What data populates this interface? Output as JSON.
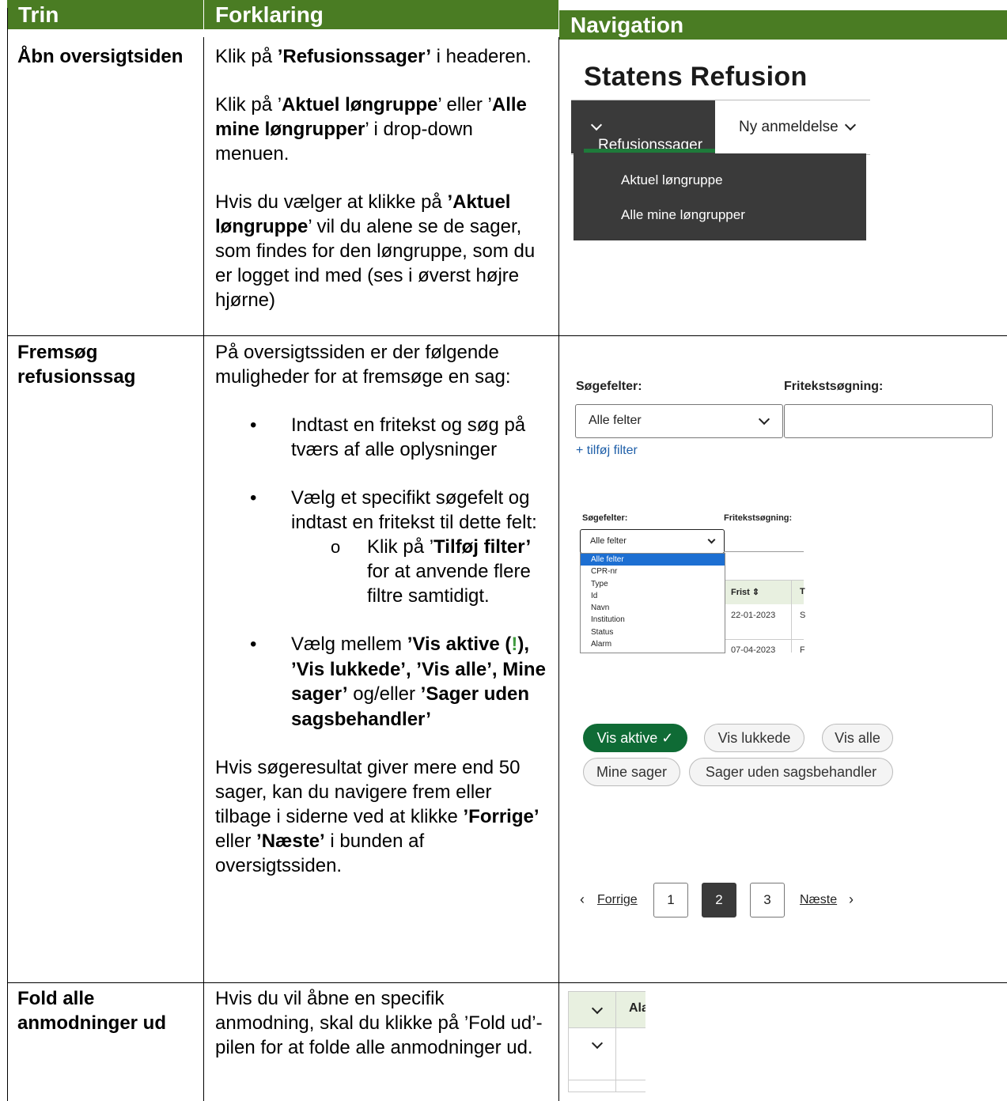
{
  "header": {
    "col1": "Trin",
    "col2": "Forklaring",
    "col3": "Navigation"
  },
  "row1": {
    "step": "Åbn oversigtsiden",
    "p1_a": "Klik på ",
    "p1_b": "’Refusionssager’",
    "p1_c": " i headeren.",
    "p2_a": "Klik på ’",
    "p2_b": "Aktuel løngruppe",
    "p2_c": "’ eller ’",
    "p2_d": "Alle mine løngrupper",
    "p2_e": "’ i drop-down menuen.",
    "p3_a": "Hvis du vælger at klikke på ",
    "p3_b": "’Aktuel løngruppe",
    "p3_c": "’ vil du alene se de sager, som findes for den løngruppe, som du er logget ind med (ses i øverst højre hjørne)"
  },
  "row2": {
    "step": "Fremsøg refusionssag",
    "intro": "På oversigtssiden er der følgende muligheder for at fremsøge en sag:",
    "b1": "Indtast en fritekst og søg på tværs af alle oplysninger",
    "b2": "Vælg et specifikt søgefelt og indtast en fritekst til dette felt:",
    "b2s_a": "Klik på ’",
    "b2s_b": "Tilføj filter’",
    "b2s_c": " for at anvende flere filtre samtidigt.",
    "b3_a": "Vælg mellem ",
    "b3_b": "’Vis aktive (",
    "b3_excl": "!",
    "b3_c": "), ’Vis lukkede’, ’Vis alle’, Mine sager’",
    "b3_d": " og/eller ",
    "b3_e": "’Sager uden sagsbehandler’",
    "p_a": "Hvis søgeresultat giver mere end 50 sager, kan du navigere frem eller tilbage i siderne ved at klikke ",
    "p_b": "’Forrige’",
    "p_c": " eller ",
    "p_d": "’Næste’",
    "p_e": " i bunden af oversigtssiden."
  },
  "row3": {
    "step": "Fold alle anmodninger ud",
    "text": "Hvis du vil åbne en specifik anmodning, skal du klikke på ’Fold ud’-pilen for at folde alle anmodninger ud."
  },
  "nav_mock": {
    "title": "Statens Refusion",
    "menu_active": "Refusionssager",
    "menu_other": "Ny anmeldelse",
    "dropdown": [
      "Aktuel løngruppe",
      "Alle mine løngrupper"
    ]
  },
  "search_mock": {
    "label_fields": "Søgefelter:",
    "label_free": "Fritekstsøgning:",
    "select_value": "Alle felter",
    "add_filter": "+ tilføj filter"
  },
  "search_mock_small": {
    "label_fields": "Søgefelter:",
    "label_free": "Fritekstsøgning:",
    "select_value": "Alle felter",
    "options": [
      "Alle felter",
      "CPR-nr",
      "Type",
      "Id",
      "Navn",
      "Institution",
      "Status",
      "Alarm"
    ],
    "col_header": "Frist",
    "col_header2": "T",
    "date1": "22-01-2023",
    "date1_tail": "S",
    "date2": "07-04-2023",
    "date2_tail": "F"
  },
  "filters": {
    "active": "Vis aktive ✓",
    "closed": "Vis lukkede",
    "all": "Vis alle",
    "mine": "Mine sager",
    "no_handler": "Sager uden sagsbehandler"
  },
  "pagination": {
    "prev": "Forrige",
    "pages": [
      "1",
      "2",
      "3"
    ],
    "next": "Næste"
  },
  "expand_mock": {
    "col": "Ala"
  },
  "colors": {
    "header_green": "#4a7c23",
    "active_green": "#0f6b35",
    "dark": "#3a3a3a"
  }
}
